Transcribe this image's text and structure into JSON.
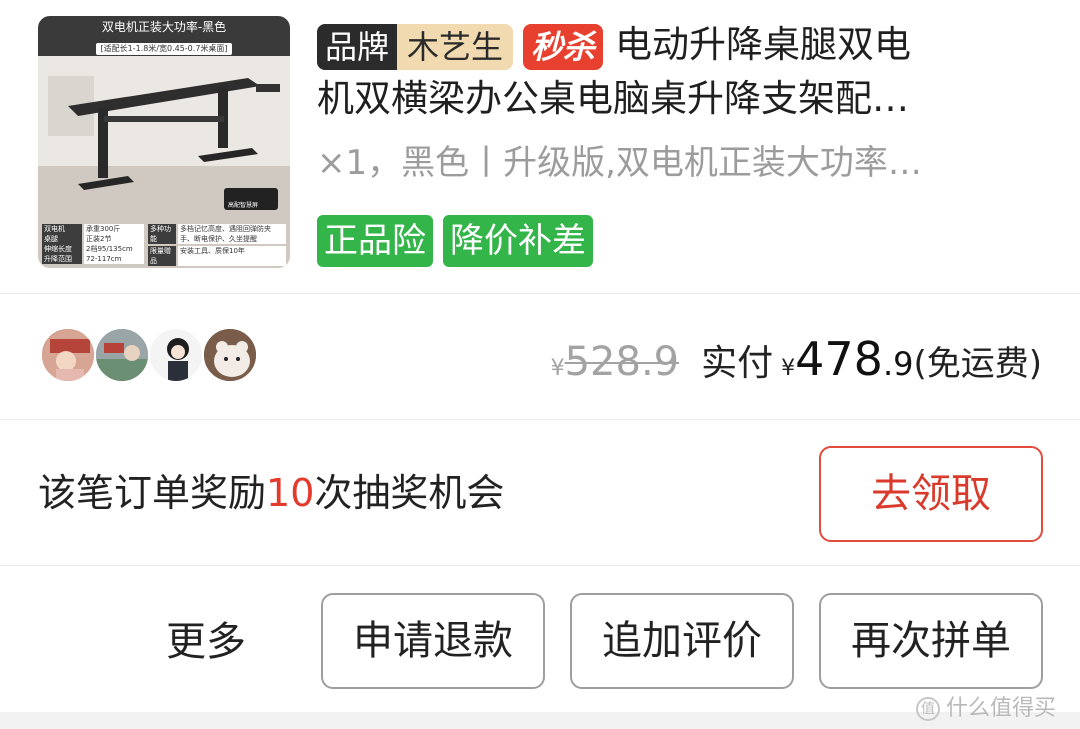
{
  "product": {
    "image": {
      "title": "双电机正装大功率-黑色",
      "subtitle": "[适配长1-1.8米/宽0.45-0.7米桌面]",
      "badge_label": "高配智慧屏",
      "specs": [
        {
          "k": "双电机",
          "v": "承重300斤"
        },
        {
          "k": "桌腿",
          "v": "正装2节"
        },
        {
          "k": "伸缩长度",
          "v": "2档95/135cm"
        },
        {
          "k": "升降范围",
          "v": "72-117cm"
        }
      ],
      "features": [
        {
          "k": "多种功能",
          "v": "多档记忆高度、遇阻回弹防夹手、断电保护、久坐提醒"
        },
        {
          "k": "限量赠品",
          "v": "安装工具、质保10年"
        }
      ]
    },
    "brand_key": "品牌",
    "brand_name": "木艺生",
    "seckill": "秒杀",
    "title_line1": "电动升降桌腿双电",
    "title_line2": "机双横梁办公桌电脑桌升降支架配…",
    "spec_text": "×1，黑色丨升级版,双电机正装大功率…",
    "tags": [
      "正品险",
      "降价补差"
    ]
  },
  "payment": {
    "original_currency": "¥",
    "original_price": "528.9",
    "paid_label": "实付",
    "paid_currency": "¥",
    "paid_int": "478",
    "paid_dec": ".9",
    "shipping": "(免运费)",
    "avatars": [
      "avatar-1",
      "avatar-2",
      "avatar-3",
      "avatar-4"
    ]
  },
  "lottery": {
    "text_prefix": "该笔订单奖励",
    "count": "10",
    "text_suffix": "次抽奖机会",
    "button": "去领取"
  },
  "actions": {
    "more": "更多",
    "buttons": [
      "申请退款",
      "追加评价",
      "再次拼单"
    ]
  },
  "watermark": "什么值得买",
  "colors": {
    "accent_red": "#e33a2b",
    "tag_green": "#33b54a",
    "muted_gray": "#9c9c9c"
  }
}
